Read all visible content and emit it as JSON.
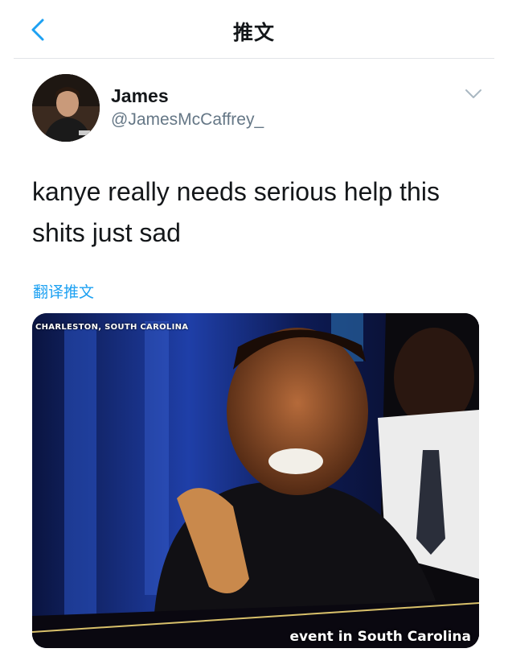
{
  "header": {
    "back_icon": "chevron-left-icon",
    "title": "推文"
  },
  "tweet": {
    "author_name": "James",
    "author_handle": "@JamesMcCaffrey_",
    "text": "kanye really needs serious help this shits just sad",
    "translate_label": "翻译推文",
    "menu_icon": "chevron-down-icon"
  },
  "media": {
    "caption_top": "CHARLESTON, SOUTH CAROLINA",
    "caption_bottom": "event in South Carolina"
  },
  "colors": {
    "accent": "#1da1f2",
    "secondary_text": "#657786",
    "divider": "#e1e4e8"
  }
}
